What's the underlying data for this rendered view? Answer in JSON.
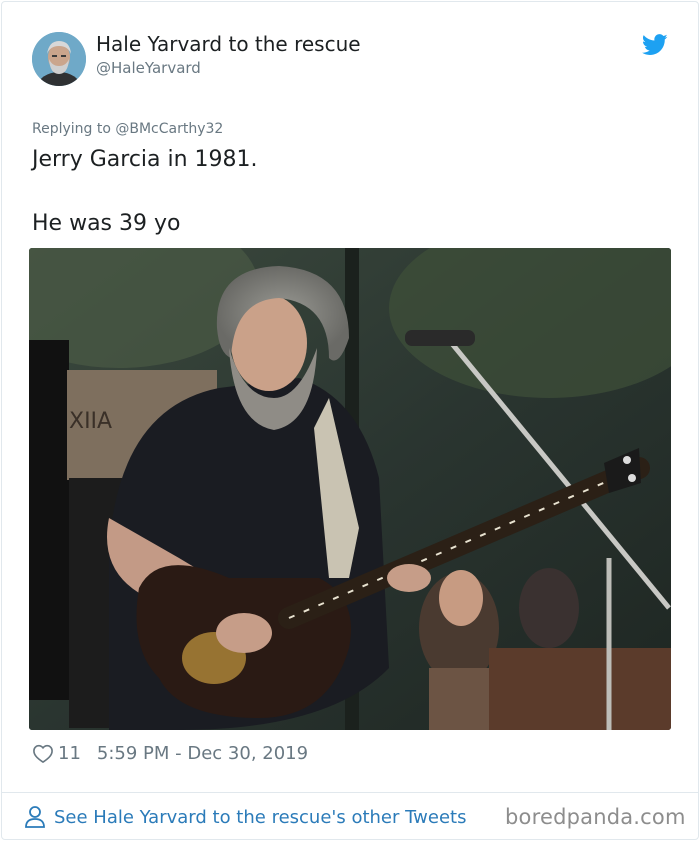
{
  "author": {
    "name": "Hale Yarvard to the rescue",
    "handle": "@HaleYarvard"
  },
  "tweet": {
    "replying_to": "Replying to @BMcCarthy32",
    "text": "Jerry Garcia in 1981.\n\nHe was 39 yo",
    "likes": "11",
    "timestamp": "5:59 PM - Dec 30, 2019"
  },
  "footer": {
    "more_tweets": "See Hale Yarvard to the rescue's other Tweets"
  },
  "watermark": "boredpanda.com",
  "colors": {
    "twitter_blue": "#1da1f2",
    "link_blue": "#2b7bb9",
    "muted": "#697882",
    "text": "#1c2022"
  },
  "icons": [
    "twitter-bird-icon",
    "heart-icon",
    "person-icon"
  ]
}
